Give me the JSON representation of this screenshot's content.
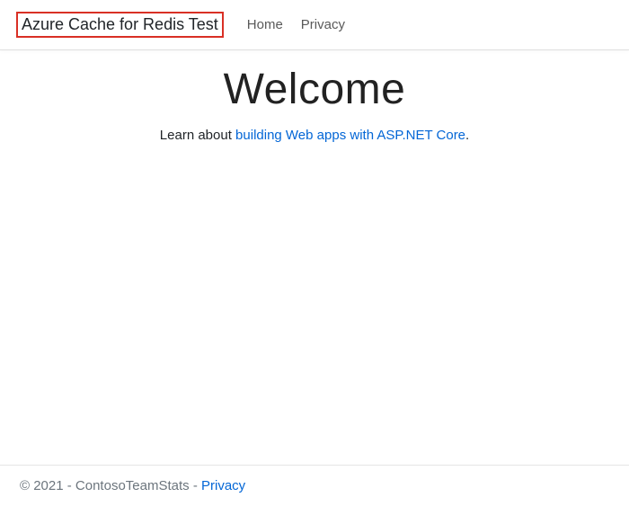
{
  "navbar": {
    "brand": "Azure Cache for Redis Test",
    "links": {
      "home": "Home",
      "privacy": "Privacy"
    }
  },
  "main": {
    "heading": "Welcome",
    "lead_prefix": "Learn about ",
    "lead_link_text": "building Web apps with ASP.NET Core",
    "lead_suffix": "."
  },
  "footer": {
    "copyright": "© 2021 - ContosoTeamStats - ",
    "privacy_link": "Privacy"
  }
}
